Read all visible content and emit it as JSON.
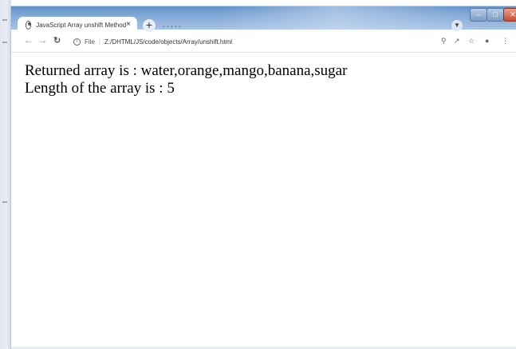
{
  "browser": {
    "tab_title": "JavaScript Array unshift Method",
    "tab_close": "×",
    "new_tab": "+",
    "scheme_label": "File",
    "url": "Z:/DHTML/JS/code/objects/Array/unshift.html",
    "icons": {
      "back": "back-arrow-icon",
      "forward": "forward-arrow-icon",
      "reload": "reload-icon",
      "site_info": "info-icon",
      "zoom": "zoom-icon",
      "share": "share-icon",
      "bookmark": "star-icon",
      "profile": "profile-icon",
      "menu": "kebab-menu-icon"
    }
  },
  "page": {
    "line1": "Returned array is : water,orange,mango,banana,sugar",
    "line2": "Length of the array is : 5"
  }
}
